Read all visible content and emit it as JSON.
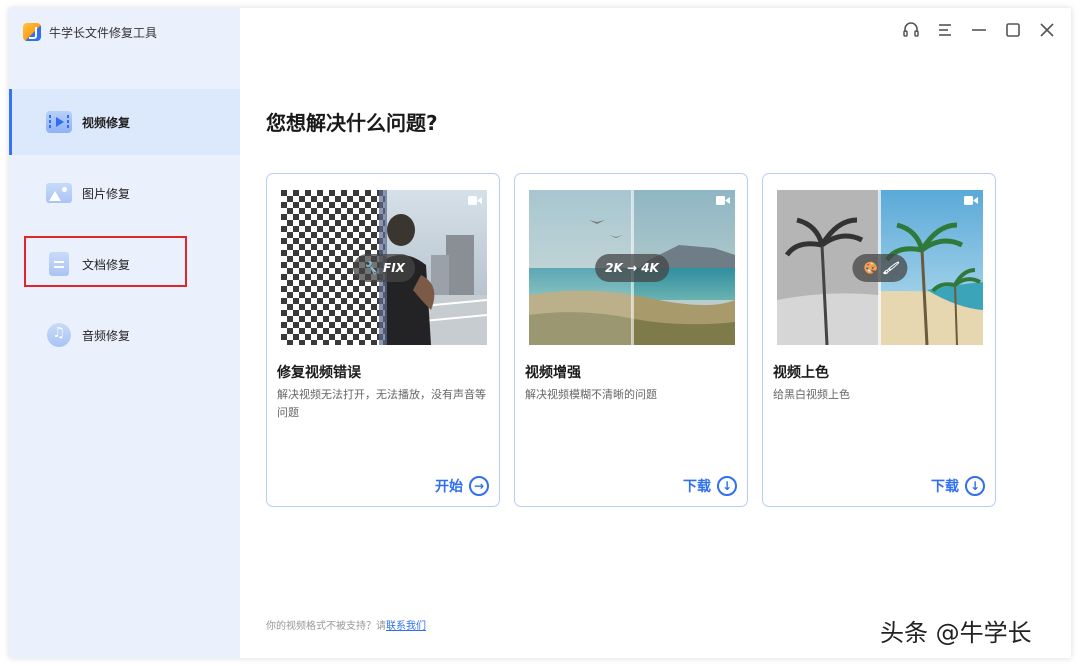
{
  "app": {
    "title": "牛学长文件修复工具"
  },
  "sidebar": {
    "items": [
      {
        "label": "视频修复",
        "icon": "video-repair-icon"
      },
      {
        "label": "图片修复",
        "icon": "image-repair-icon"
      },
      {
        "label": "文档修复",
        "icon": "document-repair-icon"
      },
      {
        "label": "音频修复",
        "icon": "audio-repair-icon"
      }
    ],
    "active_index": 0,
    "highlighted_index": 2
  },
  "window_controls": [
    "headset-icon",
    "menu-icon",
    "minimize-icon",
    "maximize-icon",
    "close-icon"
  ],
  "main": {
    "heading": "您想解决什么问题?",
    "cards": [
      {
        "badge": "FIX",
        "title": "修复视频错误",
        "desc": "解决视频无法打开，无法播放，没有声音等问题",
        "action": "开始",
        "action_icon": "arrow-right-circle-icon"
      },
      {
        "badge": "2K → 4K",
        "title": "视频增强",
        "desc": "解决视频模糊不清晰的问题",
        "action": "下载",
        "action_icon": "download-circle-icon"
      },
      {
        "badge": "",
        "title": "视频上色",
        "desc": "给黑白视频上色",
        "action": "下载",
        "action_icon": "download-circle-icon"
      }
    ]
  },
  "footer": {
    "text": "你的视频格式不被支持？请",
    "link": "联系我们"
  },
  "watermark": "头条 @牛学长",
  "colors": {
    "accent": "#2f6ff0",
    "sidebar_bg": "#eaf1fc",
    "highlight_border": "#e0262b"
  }
}
